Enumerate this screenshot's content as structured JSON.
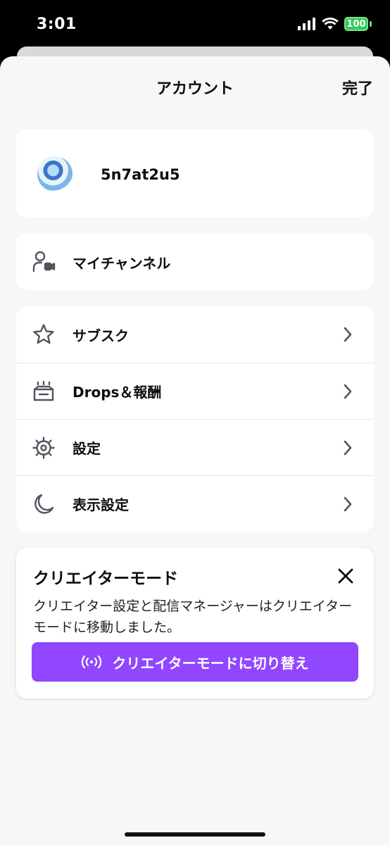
{
  "status_bar": {
    "time": "3:01",
    "battery": "100"
  },
  "nav": {
    "title": "アカウント",
    "done_label": "完了"
  },
  "profile": {
    "username": "5n7at2u5"
  },
  "channel": {
    "label": "マイチャンネル",
    "icon": "user-camera-icon"
  },
  "menu": {
    "items": [
      {
        "label": "サブスク",
        "icon": "star-icon"
      },
      {
        "label": "Drops＆報酬",
        "icon": "drops-inbox-icon"
      },
      {
        "label": "設定",
        "icon": "gear-icon"
      },
      {
        "label": "表示設定",
        "icon": "moon-icon"
      }
    ]
  },
  "creator_mode": {
    "title": "クリエイターモード",
    "description": "クリエイター設定と配信マネージャーはクリエイターモードに移動しました。",
    "button_label": "クリエイターモードに切り替え",
    "button_icon": "broadcast-icon"
  },
  "colors": {
    "accent": "#9147ff",
    "background": "#f7f7f8",
    "card": "#ffffff",
    "battery": "#34c759"
  }
}
